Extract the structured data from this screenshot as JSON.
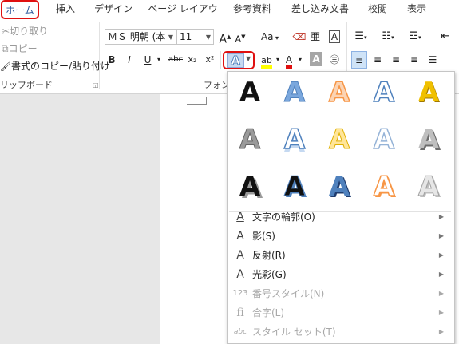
{
  "tabs": [
    "ホーム",
    "挿入",
    "デザイン",
    "ページ レイアウト",
    "参考資料",
    "差し込み文書",
    "校閲",
    "表示"
  ],
  "active_tab": "ホーム",
  "clipboard": {
    "cut": "切り取り",
    "copy": "コピー",
    "format_painter": "書式のコピー/貼り付け",
    "group_label": "リップボード"
  },
  "font": {
    "name": "ＭＳ 明朝 (本",
    "size": "11",
    "group_label": "フォント",
    "grow": "A",
    "shrink": "A",
    "case": "Aa",
    "bold": "B",
    "italic": "I",
    "underline": "U",
    "strike": "abc",
    "subscript": "x₂",
    "superscript": "x²"
  },
  "effects_menu": {
    "gallery_letter": "A",
    "items": [
      {
        "label": "文字の輪郭(O)",
        "icon": "A",
        "enabled": true
      },
      {
        "label": "影(S)",
        "icon": "A",
        "enabled": true
      },
      {
        "label": "反射(R)",
        "icon": "A",
        "enabled": true
      },
      {
        "label": "光彩(G)",
        "icon": "A",
        "enabled": true
      },
      {
        "label": "番号スタイル(N)",
        "icon": "123",
        "enabled": false
      },
      {
        "label": "合字(L)",
        "icon": "fi",
        "enabled": false
      },
      {
        "label": "スタイル セット(T)",
        "icon": "abc",
        "enabled": false
      }
    ]
  },
  "colors": {
    "accent": "#2b579a",
    "highlight_red": "#e01010",
    "gallery_blue": "#4f81bd",
    "gallery_orange": "#f79646",
    "gallery_gold": "#f0c000"
  }
}
